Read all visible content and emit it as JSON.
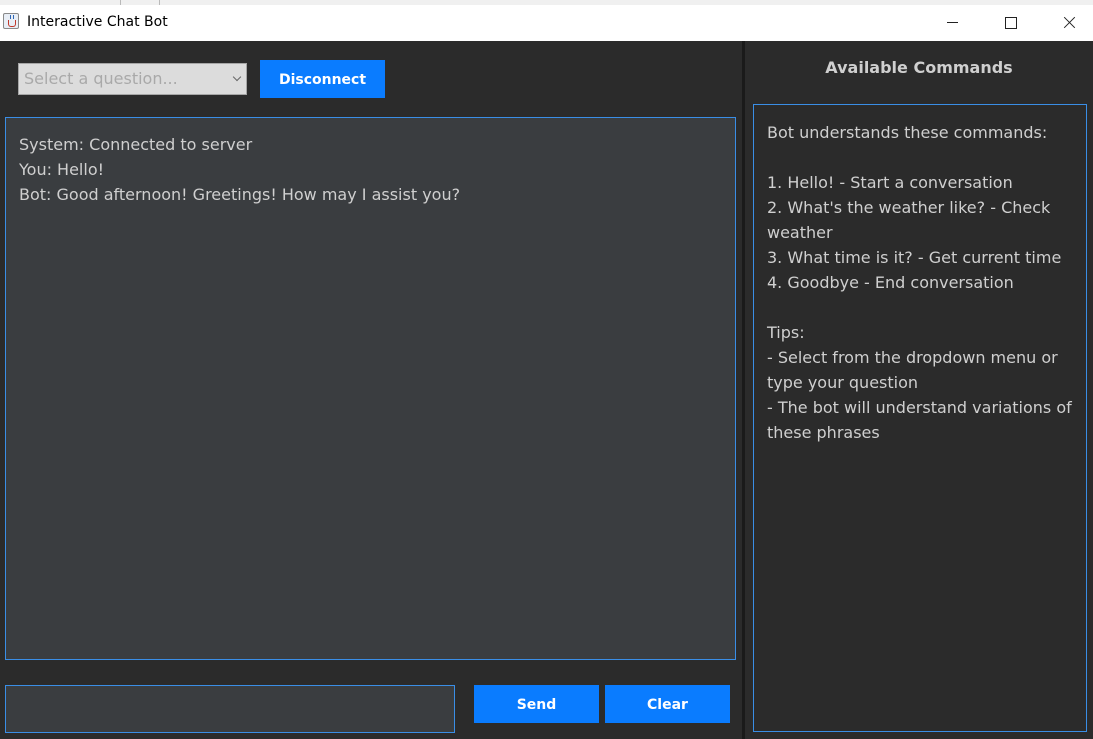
{
  "window": {
    "title": "Interactive Chat Bot"
  },
  "toolbar": {
    "question_placeholder": "Select a question...",
    "disconnect_label": "Disconnect"
  },
  "chat": {
    "messages": [
      "System: Connected to server",
      "You: Hello!",
      "Bot: Good afternoon! Greetings! How may I assist you?"
    ]
  },
  "input": {
    "value": "",
    "send_label": "Send",
    "clear_label": "Clear"
  },
  "commands_panel": {
    "title": "Available Commands",
    "lines": [
      "Bot understands these commands:",
      "",
      "1. Hello! - Start a conversation",
      "2. What's the weather like? - Check",
      "weather",
      "3. What time is it? - Get current time",
      "4. Goodbye - End conversation",
      "",
      "Tips:",
      "- Select from the dropdown menu or",
      "type your question",
      "- The bot will understand variations of",
      "these phrases"
    ]
  },
  "colors": {
    "accent": "#0a7cff",
    "background": "#2b2b2b",
    "text_area": "#3a3d40",
    "border": "#3a8ee6",
    "text": "#cfcfcf"
  },
  "icons": {
    "app": "java-cup-icon",
    "minimize": "minimize-icon",
    "maximize": "maximize-icon",
    "close": "close-icon",
    "dropdown": "chevron-down-icon"
  }
}
